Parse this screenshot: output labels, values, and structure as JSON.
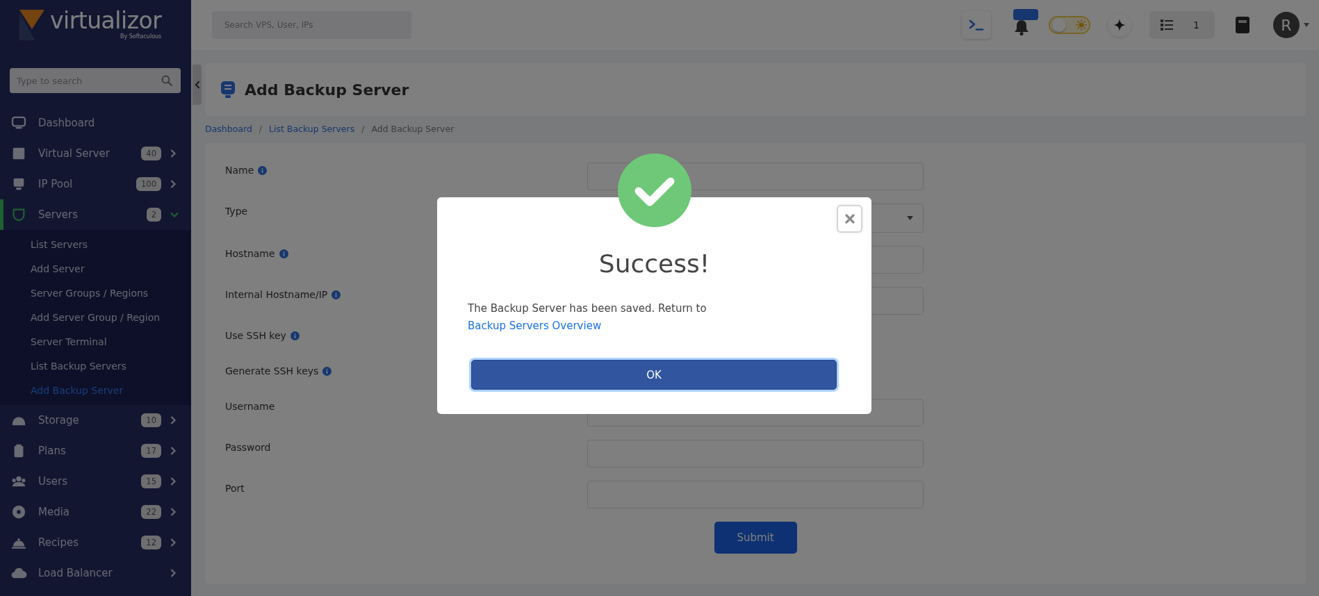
{
  "sidebar": {
    "logo": {
      "name": "virtualizor",
      "tagline": "By Softaculous"
    },
    "search": {
      "placeholder": "Type to search"
    },
    "items": [
      {
        "label": "Dashboard",
        "selected": false
      },
      {
        "label": "Virtual Server",
        "badge": "40",
        "expanded": false,
        "selected": false
      },
      {
        "label": "IP Pool",
        "badge": "100",
        "expanded": false,
        "selected": false
      },
      {
        "label": "Servers",
        "badge": "2",
        "expanded": true,
        "selected": true,
        "children": [
          {
            "label": "List Servers",
            "selected": false
          },
          {
            "label": "Add Server",
            "selected": false
          },
          {
            "label": "Server Groups / Regions",
            "selected": false
          },
          {
            "label": "Add Server Group / Region",
            "selected": false
          },
          {
            "label": "Server Terminal",
            "selected": false
          },
          {
            "label": "List Backup Servers",
            "selected": false
          },
          {
            "label": "Add Backup Server",
            "selected": true
          }
        ]
      },
      {
        "label": "Storage",
        "badge": "10",
        "expanded": false,
        "selected": false
      },
      {
        "label": "Plans",
        "badge": "17",
        "expanded": false,
        "selected": false
      },
      {
        "label": "Users",
        "badge": "15",
        "expanded": false,
        "selected": false
      },
      {
        "label": "Media",
        "badge": "22",
        "expanded": false,
        "selected": false
      },
      {
        "label": "Recipes",
        "badge": "12",
        "expanded": false,
        "selected": false
      },
      {
        "label": "Load Balancer",
        "expanded": false,
        "selected": false
      }
    ]
  },
  "topbar": {
    "search": {
      "placeholder": "Search VPS, User, IPs"
    },
    "theme_toggle": {
      "on": false
    },
    "count": "1",
    "avatar": {
      "initial": "R"
    }
  },
  "header": {
    "title": "Add Backup Server"
  },
  "breadcrumb": [
    {
      "label": "Dashboard",
      "kind": "link"
    },
    {
      "separator": "/",
      "label": "List Backup Servers",
      "kind": "link"
    },
    {
      "separator": "/",
      "label": "Add Backup Server",
      "kind": "current"
    }
  ],
  "form": {
    "fields": [
      {
        "label": "Name",
        "info": true,
        "kind": "text"
      },
      {
        "label": "Type",
        "info": false,
        "kind": "select"
      },
      {
        "label": "Hostname",
        "info": true,
        "kind": "text"
      },
      {
        "label": "Internal Hostname/IP",
        "info": true,
        "kind": "text"
      },
      {
        "label": "Use SSH key",
        "info": true
      },
      {
        "label": "Generate SSH keys",
        "info": true
      },
      {
        "label": "Username",
        "info": false,
        "kind": "text"
      },
      {
        "label": "Password",
        "info": false,
        "kind": "text"
      },
      {
        "label": "Port",
        "info": false,
        "kind": "text"
      }
    ],
    "submit": "Submit"
  },
  "modal": {
    "title": "Success!",
    "message": "The Backup Server has been saved. Return to",
    "link": "Backup Servers Overview",
    "ok_button": {
      "label": "OK",
      "focused": true
    }
  }
}
